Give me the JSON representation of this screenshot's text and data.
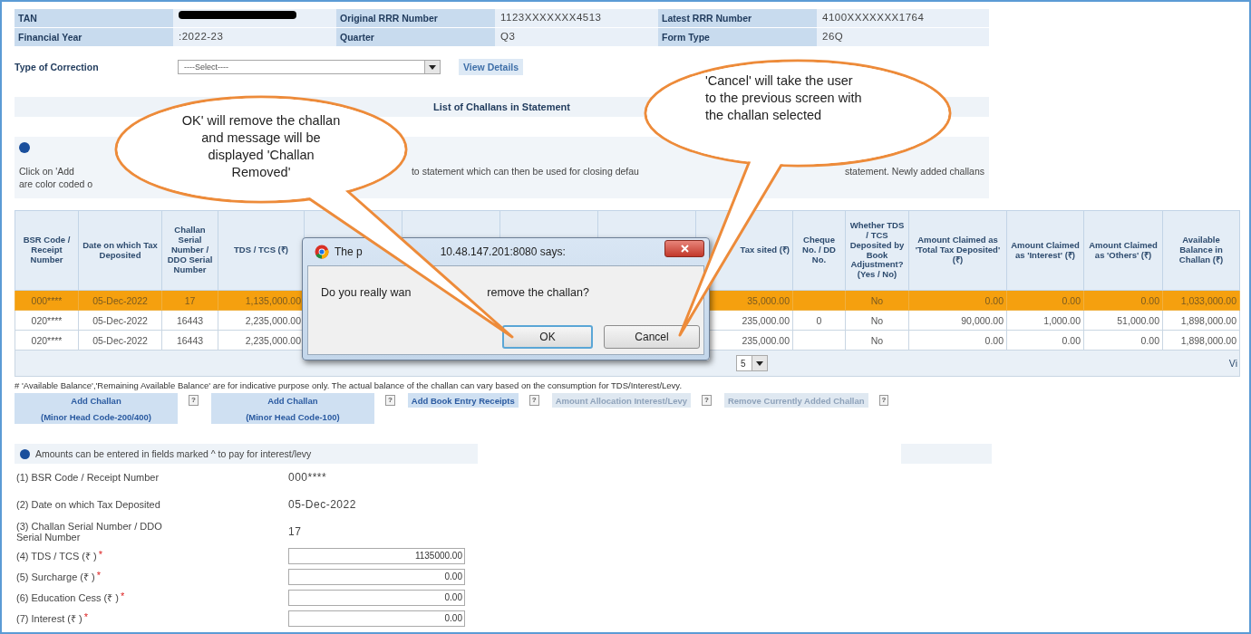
{
  "header_info": [
    {
      "label": "TAN",
      "redacted": true
    },
    {
      "label": "Original RRR Number",
      "value": "1123XXXXXXX4513"
    },
    {
      "label": "Latest RRR Number",
      "value": "4100XXXXXXX1764"
    },
    {
      "label": "Financial Year",
      "value": ":2022-23"
    },
    {
      "label": "Quarter",
      "value": "Q3"
    },
    {
      "label": "Form Type",
      "value": "26Q"
    }
  ],
  "correction": {
    "label": "Type of Correction",
    "select": "----Select----",
    "button": "View Details"
  },
  "list_title": "List of Challans in Statement",
  "info": {
    "lines": [
      [
        "Click on 'Add",
        "to statement which can then be used for closing defau",
        "statement. Newly added challans"
      ],
      [
        "are color coded o"
      ]
    ]
  },
  "table": {
    "columns": [
      {
        "label": "BSR Code / Receipt Number"
      },
      {
        "label": "Date on which Tax Deposited"
      },
      {
        "label": "Challan Serial Number / DDO Serial Number"
      },
      {
        "label": "TDS / TCS (₹)"
      },
      {},
      {},
      {},
      {},
      {
        "label": "Tax sited (₹)"
      },
      {
        "label": "Cheque No. / DD No."
      },
      {
        "label": "Whether TDS / TCS Deposited by Book Adjustment? (Yes / No)"
      },
      {
        "label": "Amount Claimed as 'Total Tax Deposited' (₹)"
      },
      {
        "label": "Amount Claimed as 'Interest' (₹)"
      },
      {
        "label": "Amount Claimed as 'Others' (₹)"
      },
      {
        "label": "Available Balance in Challan (₹)"
      }
    ],
    "rows": [
      {
        "selected": true,
        "cells": [
          "000****",
          "05-Dec-2022",
          "17",
          "1,135,000.00",
          null,
          null,
          null,
          null,
          "35,000.00",
          null,
          "No",
          "0.00",
          "0.00",
          "0.00",
          "1,033,000.00"
        ]
      },
      {
        "selected": false,
        "cells": [
          "020****",
          "05-Dec-2022",
          "16443",
          "2,235,000.00",
          null,
          null,
          null,
          null,
          "235,000.00",
          "0",
          "No",
          "90,000.00",
          "1,000.00",
          "51,000.00",
          "1,898,000.00"
        ]
      },
      {
        "selected": false,
        "cells": [
          "020****",
          "05-Dec-2022",
          "16443",
          "2,235,000.00",
          null,
          null,
          null,
          null,
          "235,000.00",
          null,
          "No",
          "0.00",
          "0.00",
          "0.00",
          "1,898,000.00"
        ]
      }
    ],
    "pager": {
      "page_size": "5",
      "link": "Vi"
    }
  },
  "footnote": "# 'Available Balance','Remaining Available Balance' are for indicative purpose only. The actual balance of the challan can vary based on the consumption for TDS/Interest/Levy.",
  "actions": [
    {
      "lines": [
        "Add Challan",
        "(Minor Head Code-200/400)"
      ],
      "disabled": false,
      "help": "?"
    },
    {
      "lines": [
        "Add Challan",
        "(Minor Head Code-100)"
      ],
      "disabled": false,
      "help": "?"
    },
    {
      "lines": [
        "Add Book Entry Receipts"
      ],
      "disabled": false,
      "help": "?"
    },
    {
      "lines": [
        "Amount Allocation Interest/Levy"
      ],
      "disabled": true,
      "help": "?"
    },
    {
      "lines": [
        "Remove Currently Added Challan"
      ],
      "disabled": true,
      "help": "?"
    }
  ],
  "form": {
    "note": "Amounts can be entered in fields marked ^ to pay for interest/levy",
    "fields": [
      {
        "kind": "text",
        "label": "(1) BSR Code / Receipt Number",
        "value": "000****"
      },
      {
        "kind": "text",
        "label": "(2) Date on which Tax Deposited",
        "value": "05-Dec-2022"
      },
      {
        "kind": "text",
        "label": "(3) Challan Serial Number / DDO Serial Number",
        "value": "17"
      },
      {
        "kind": "input",
        "label": "(4) TDS / TCS (₹ )",
        "mark": "*",
        "value": "1135000.00"
      },
      {
        "kind": "input",
        "label": "(5) Surcharge (₹ )",
        "mark": "*",
        "value": "0.00"
      },
      {
        "kind": "input",
        "label": "(6) Education Cess (₹ )",
        "mark": "*",
        "value": "0.00"
      },
      {
        "kind": "input",
        "label": "(7) Interest (₹ )",
        "mark": "*",
        "value": "0.00"
      }
    ]
  },
  "dialog": {
    "title": [
      "The p",
      "10.48.147.201:8080 says:"
    ],
    "message": [
      "Do you really wan",
      "remove the challan?"
    ],
    "buttons": [
      "OK",
      "Cancel"
    ]
  },
  "callouts": [
    {
      "text": "OK' will remove the challan and message will be displayed 'Challan Removed'"
    },
    {
      "text": "'Cancel' will take the user to the previous screen with the challan selected"
    }
  ]
}
